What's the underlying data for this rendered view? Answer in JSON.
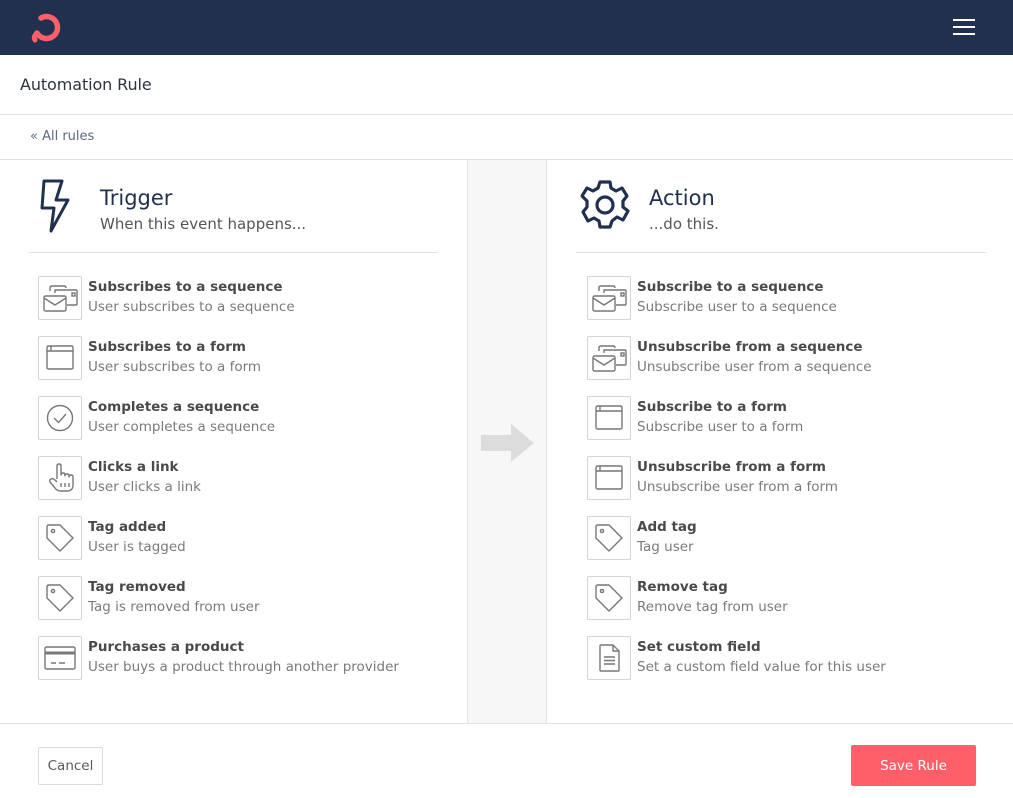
{
  "app": {
    "brand_color": "#fe5f69",
    "nav_color": "#20304e",
    "logo_icon": "ring-logo-icon",
    "menu_icon": "hamburger-menu-icon"
  },
  "header": {
    "title": "Automation Rule"
  },
  "breadcrumb": {
    "back_label": "« All rules"
  },
  "trigger": {
    "icon": "lightning-bolt-icon",
    "title": "Trigger",
    "subtitle": "When this event happens...",
    "items": [
      {
        "icon": "sequence-envelope-icon",
        "title": "Subscribes to a sequence",
        "description": "User subscribes to a sequence"
      },
      {
        "icon": "form-window-icon",
        "title": "Subscribes to a form",
        "description": "User subscribes to a form"
      },
      {
        "icon": "check-circle-icon",
        "title": "Completes a sequence",
        "description": "User completes a sequence"
      },
      {
        "icon": "hand-pointer-icon",
        "title": "Clicks a link",
        "description": "User clicks a link"
      },
      {
        "icon": "tag-icon",
        "title": "Tag added",
        "description": "User is tagged"
      },
      {
        "icon": "tag-icon",
        "title": "Tag removed",
        "description": "Tag is removed from user"
      },
      {
        "icon": "credit-card-icon",
        "title": "Purchases a product",
        "description": "User buys a product through another provider"
      }
    ]
  },
  "connector": {
    "icon": "arrow-right-icon"
  },
  "action": {
    "icon": "gear-icon",
    "title": "Action",
    "subtitle": "...do this.",
    "items": [
      {
        "icon": "sequence-envelope-icon",
        "title": "Subscribe to a sequence",
        "description": "Subscribe user to a sequence"
      },
      {
        "icon": "sequence-envelope-icon",
        "title": "Unsubscribe from a sequence",
        "description": "Unsubscribe user from a sequence"
      },
      {
        "icon": "form-window-icon",
        "title": "Subscribe to a form",
        "description": "Subscribe user to a form"
      },
      {
        "icon": "form-window-icon",
        "title": "Unsubscribe from a form",
        "description": "Unsubscribe user from a form"
      },
      {
        "icon": "tag-icon",
        "title": "Add tag",
        "description": "Tag user"
      },
      {
        "icon": "tag-icon",
        "title": "Remove tag",
        "description": "Remove tag from user"
      },
      {
        "icon": "document-icon",
        "title": "Set custom field",
        "description": "Set a custom field value for this user"
      }
    ]
  },
  "footer": {
    "cancel_label": "Cancel",
    "save_label": "Save Rule"
  }
}
